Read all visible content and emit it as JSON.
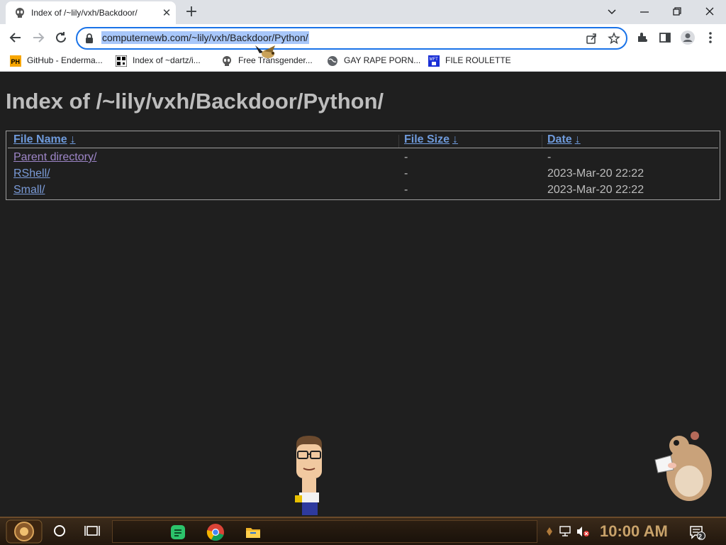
{
  "browser": {
    "tab_title": "Index of /~lily/vxh/Backdoor/",
    "address": "computernewb.com/~lily/vxh/Backdoor/Python/",
    "bookmarks": [
      {
        "label": "GitHub - Enderma...",
        "icon": "ph-icon"
      },
      {
        "label": "Index of ~dartz/i...",
        "icon": "qr-icon"
      },
      {
        "label": "Free Transgender...",
        "icon": "alien-icon"
      },
      {
        "label": "GAY RAPE PORN...",
        "icon": "globe-icon"
      },
      {
        "label": "FILE ROULETTE",
        "icon": "mft-icon"
      }
    ]
  },
  "page": {
    "heading": "Index of /~lily/vxh/Backdoor/Python/",
    "columns": {
      "name": "File Name",
      "size": "File Size",
      "date": "Date",
      "sort_arrow": "↓"
    },
    "rows": [
      {
        "name": "Parent directory/",
        "size": "-",
        "date": "-"
      },
      {
        "name": "RShell/",
        "size": "-",
        "date": "2023-Mar-20 22:22"
      },
      {
        "name": "Small/",
        "size": "-",
        "date": "2023-Mar-20 22:22"
      }
    ]
  },
  "taskbar": {
    "clock": "10:00 AM",
    "notification_count": "2"
  },
  "colors": {
    "accent": "#1a73e8",
    "link": "#7a9bd8",
    "visited_link": "#9e86c8",
    "page_bg": "#1f1f1f",
    "heading": "#bdbdbd"
  }
}
